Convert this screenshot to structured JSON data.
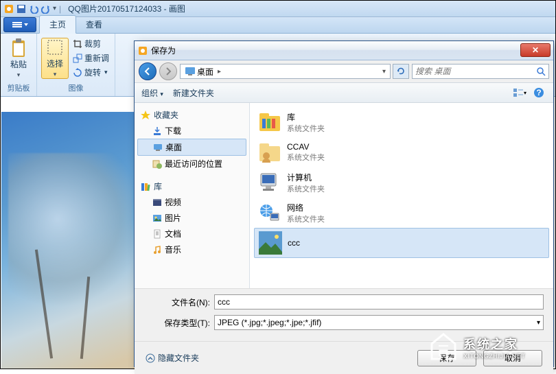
{
  "titlebar": {
    "text": "QQ图片20170517124033 - 画图"
  },
  "tabs": {
    "home": "主页",
    "view": "查看"
  },
  "ribbon": {
    "clipboard": {
      "label": "剪贴板",
      "paste": "粘贴"
    },
    "image": {
      "label": "图像",
      "select": "选择",
      "crop": "裁剪",
      "resize": "重新调",
      "rotate": "旋转"
    }
  },
  "dialog": {
    "title": "保存为",
    "breadcrumb": {
      "root": "桌面"
    },
    "search": {
      "placeholder": "搜索 桌面"
    },
    "toolbar": {
      "organize": "组织",
      "newfolder": "新建文件夹"
    },
    "navpane": {
      "favorites": {
        "hdr": "收藏夹",
        "items": [
          "下载",
          "桌面",
          "最近访问的位置"
        ]
      },
      "libraries": {
        "hdr": "库",
        "items": [
          "视频",
          "图片",
          "文档",
          "音乐"
        ]
      }
    },
    "files": [
      {
        "name": "库",
        "sub": "系统文件夹"
      },
      {
        "name": "CCAV",
        "sub": "系统文件夹"
      },
      {
        "name": "计算机",
        "sub": "系统文件夹"
      },
      {
        "name": "网络",
        "sub": "系统文件夹"
      },
      {
        "name": "ccc",
        "sub": ""
      }
    ],
    "form": {
      "name_label": "文件名(N):",
      "name_value": "ccc",
      "type_label": "保存类型(T):",
      "type_value": "JPEG (*.jpg;*.jpeg;*.jpe;*.jfif)"
    },
    "footer": {
      "hide": "隐藏文件夹",
      "save": "保存",
      "cancel": "取消"
    }
  },
  "watermark": {
    "cn": "系统之家",
    "en": "XITONGZHIJIA.NET"
  }
}
